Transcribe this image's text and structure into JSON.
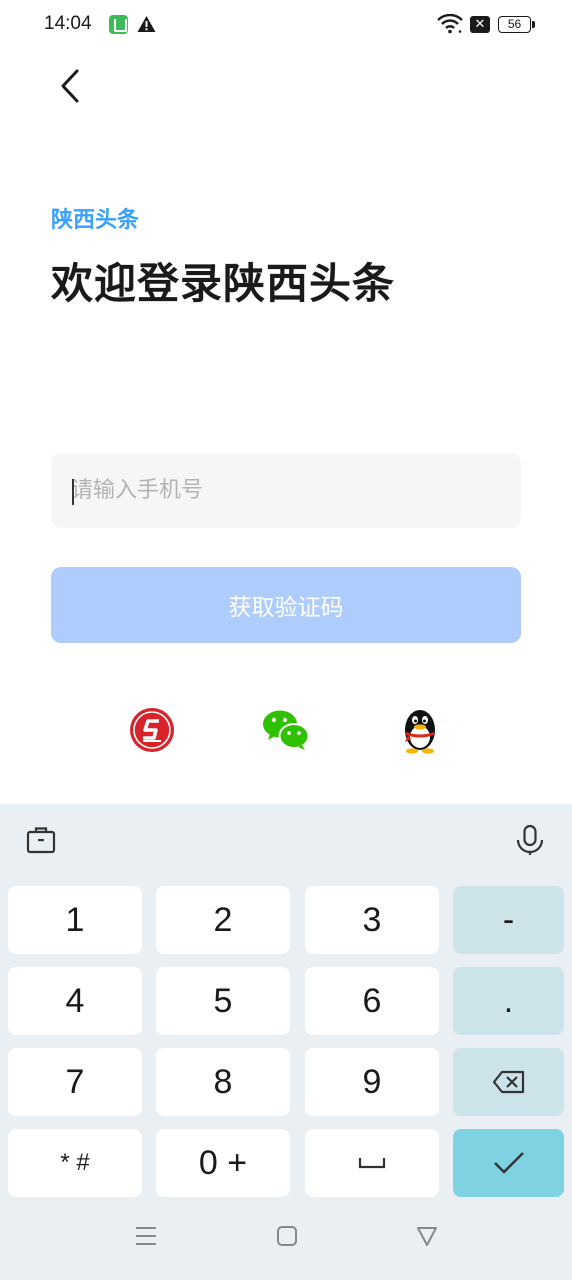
{
  "status_bar": {
    "time": "14:04",
    "battery": "56",
    "icons": [
      "app-notification-icon",
      "warning-icon",
      "wifi-icon",
      "no-sim-icon",
      "battery-icon"
    ]
  },
  "header": {
    "back_icon": "chevron-left-icon",
    "brand": "陕西头条",
    "title": "欢迎登录陕西头条"
  },
  "login": {
    "phone_placeholder": "请输入手机号",
    "phone_value": "",
    "get_code_label": "获取验证码"
  },
  "social_login": [
    "s-logo-icon",
    "wechat-icon",
    "qq-icon"
  ],
  "colors": {
    "brand": "#3aa0ff",
    "button_disabled": "#aecdfc",
    "input_bg": "#f6f6f6",
    "keyboard_bg": "#e9eff3",
    "key_func": "#cde3ea",
    "key_ok": "#7fd2e2"
  },
  "keyboard": {
    "toolbar": [
      "clipboard-icon",
      "microphone-icon"
    ],
    "rows": [
      [
        "1",
        "2",
        "3",
        "-"
      ],
      [
        "4",
        "5",
        "6",
        "."
      ],
      [
        "7",
        "8",
        "9",
        "backspace"
      ],
      [
        "* #",
        "0 +",
        "space",
        "confirm"
      ]
    ]
  },
  "nav_bar": [
    "menu-icon",
    "home-icon",
    "back-triangle-icon"
  ]
}
